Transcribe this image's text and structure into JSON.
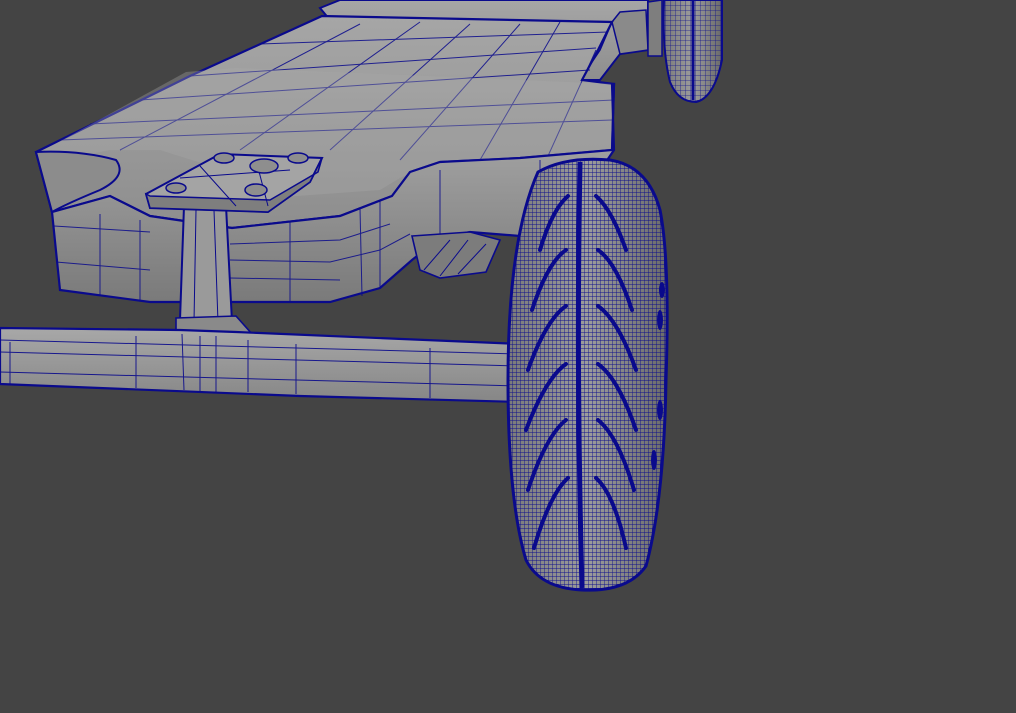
{
  "viewport": {
    "background_color": "#444444",
    "wireframe_color": "#0a0a8c",
    "surface_color": "#9a9a9a",
    "surface_shadow_color": "#6e6e6e",
    "surface_highlight_color": "#b4b4b4"
  },
  "scene": {
    "objects": [
      {
        "name": "chassis-deck",
        "icon": "mesh-icon"
      },
      {
        "name": "axle-beam",
        "icon": "mesh-icon"
      },
      {
        "name": "suspension-mount",
        "icon": "mesh-icon"
      },
      {
        "name": "front-tire",
        "icon": "tire-icon"
      },
      {
        "name": "rear-tire",
        "icon": "tire-icon"
      }
    ]
  }
}
